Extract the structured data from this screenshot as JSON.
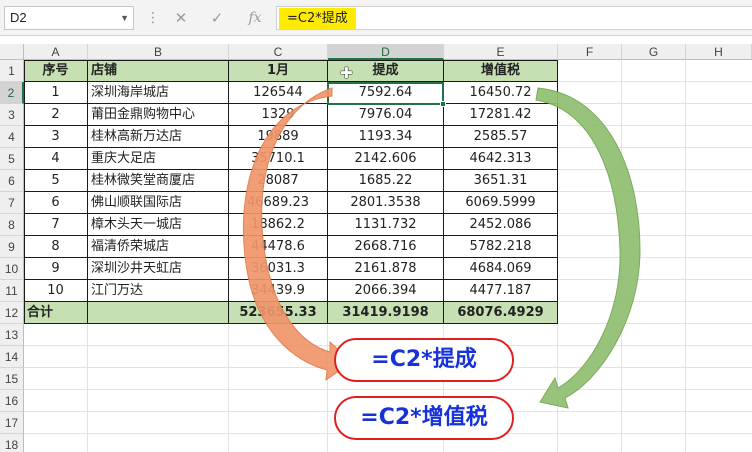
{
  "name_box": "D2",
  "formula_bar": {
    "cancel_icon": "close-icon",
    "enter_icon": "check-icon",
    "fx_label": "fx",
    "formula": "=C2*提成"
  },
  "columns": [
    "A",
    "B",
    "C",
    "D",
    "E",
    "F",
    "G",
    "H"
  ],
  "rows": [
    "1",
    "2",
    "3",
    "4",
    "5",
    "6",
    "7",
    "8",
    "9",
    "10",
    "11",
    "12",
    "13",
    "14",
    "15",
    "16",
    "17",
    "18"
  ],
  "table": {
    "headers": [
      "序号",
      "店铺",
      "1月",
      "提成",
      "增值税"
    ],
    "rows": [
      [
        "1",
        "深圳海岸城店",
        "126544",
        "7592.64",
        "16450.72"
      ],
      [
        "2",
        "莆田金鼎购物中心",
        "1329",
        "7976.04",
        "17281.42"
      ],
      [
        "3",
        "桂林高新万达店",
        "19889",
        "1193.34",
        "2585.57"
      ],
      [
        "4",
        "重庆大足店",
        "35710.1",
        "2142.606",
        "4642.313"
      ],
      [
        "5",
        "桂林微笑堂商厦店",
        "28087",
        "1685.22",
        "3651.31"
      ],
      [
        "6",
        "佛山顺联国际店",
        "46689.23",
        "2801.3538",
        "6069.5999"
      ],
      [
        "7",
        "樟木头天一城店",
        "18862.2",
        "1131.732",
        "2452.086"
      ],
      [
        "8",
        "福清侨荣城店",
        "44478.6",
        "2668.716",
        "5782.218"
      ],
      [
        "9",
        "深圳沙井天虹店",
        "36031.3",
        "2161.878",
        "4684.069"
      ],
      [
        "10",
        "江门万达",
        "34439.9",
        "2066.394",
        "4477.187"
      ]
    ],
    "total": [
      "合计",
      "",
      "523655.33",
      "31419.9198",
      "68076.4929"
    ]
  },
  "callouts": {
    "commission": "=C2*提成",
    "vat": "=C2*增值税"
  },
  "colors": {
    "header_fill": "#c6e0b4",
    "formula_highlight": "#ffeb00",
    "orange_arrow": "#f0956a",
    "green_arrow": "#8fbf6f",
    "callout_border": "#e02020",
    "callout_text": "#1632d8"
  }
}
